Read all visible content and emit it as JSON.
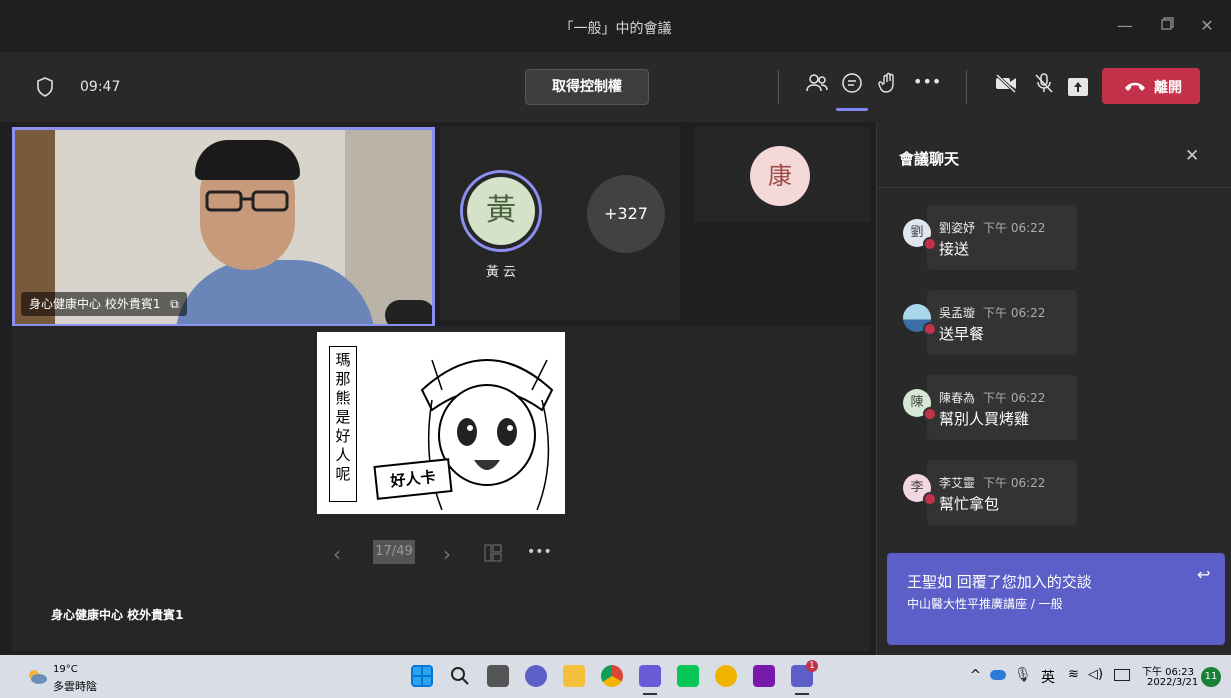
{
  "window": {
    "title": "「一般」中的會議"
  },
  "meeting": {
    "timer": "09:47",
    "take_control_label": "取得控制權",
    "leave_label": "離開"
  },
  "stage": {
    "video_tile_label": "身心健康中心 校外貴賓1",
    "participant_huang": {
      "initial": "黃",
      "name": "黃 云"
    },
    "overflow_count": "+327",
    "participant_kang": {
      "initial": "康"
    },
    "slide": {
      "vertical_text": "瑪那熊是好人呢",
      "card_text": "好人卡",
      "page_indicator": "17/49"
    },
    "presenter_label": "身心健康中心 校外貴賓1"
  },
  "chat": {
    "title": "會議聊天",
    "messages": [
      {
        "initial": "劉",
        "name": "劉姿妤",
        "time": "下午 06:22",
        "text": "接送"
      },
      {
        "initial": "",
        "name": "吳孟璇",
        "time": "下午 06:22",
        "text": "送早餐"
      },
      {
        "initial": "陳",
        "name": "陳春為",
        "time": "下午 06:22",
        "text": "幫別人買烤雞"
      },
      {
        "initial": "李",
        "name": "李艾靈",
        "time": "下午 06:22",
        "text": "幫忙拿包"
      }
    ]
  },
  "toast": {
    "title": "王聖如 回覆了您加入的交談",
    "subtitle": "中山醫大性平推廣講座 / 一般"
  },
  "taskbar": {
    "weather_temp": "19°C",
    "weather_desc": "多雲時陰",
    "ime": "英",
    "clock_time": "下午 06:23",
    "clock_date": "2022/3/21",
    "notification_count": "11",
    "teams_badge": "1"
  },
  "colors": {
    "accent": "#5b5fc7",
    "leave": "#c4314b",
    "chat_bg": "#292929",
    "taskbar_bg": "#d9dde6"
  }
}
